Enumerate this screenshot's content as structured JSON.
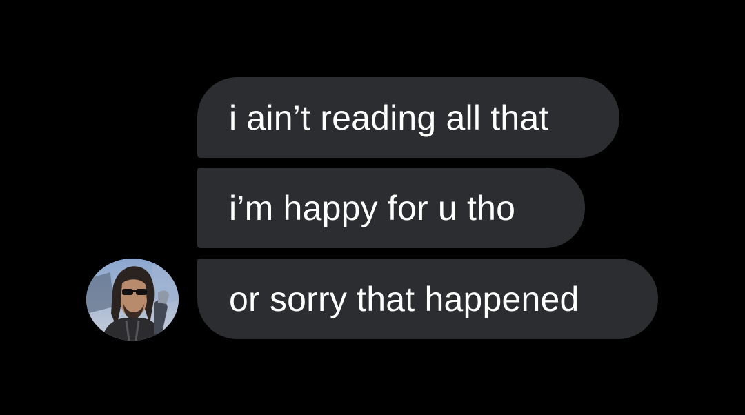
{
  "conversation": {
    "messages": [
      {
        "text": "i ain’t reading all that"
      },
      {
        "text": "i’m happy for u tho"
      },
      {
        "text": "or sorry that happened"
      }
    ]
  },
  "colors": {
    "background": "#000000",
    "bubble": "#2b2d30",
    "text": "#ffffff"
  },
  "avatar": {
    "icon": "profile-photo"
  }
}
